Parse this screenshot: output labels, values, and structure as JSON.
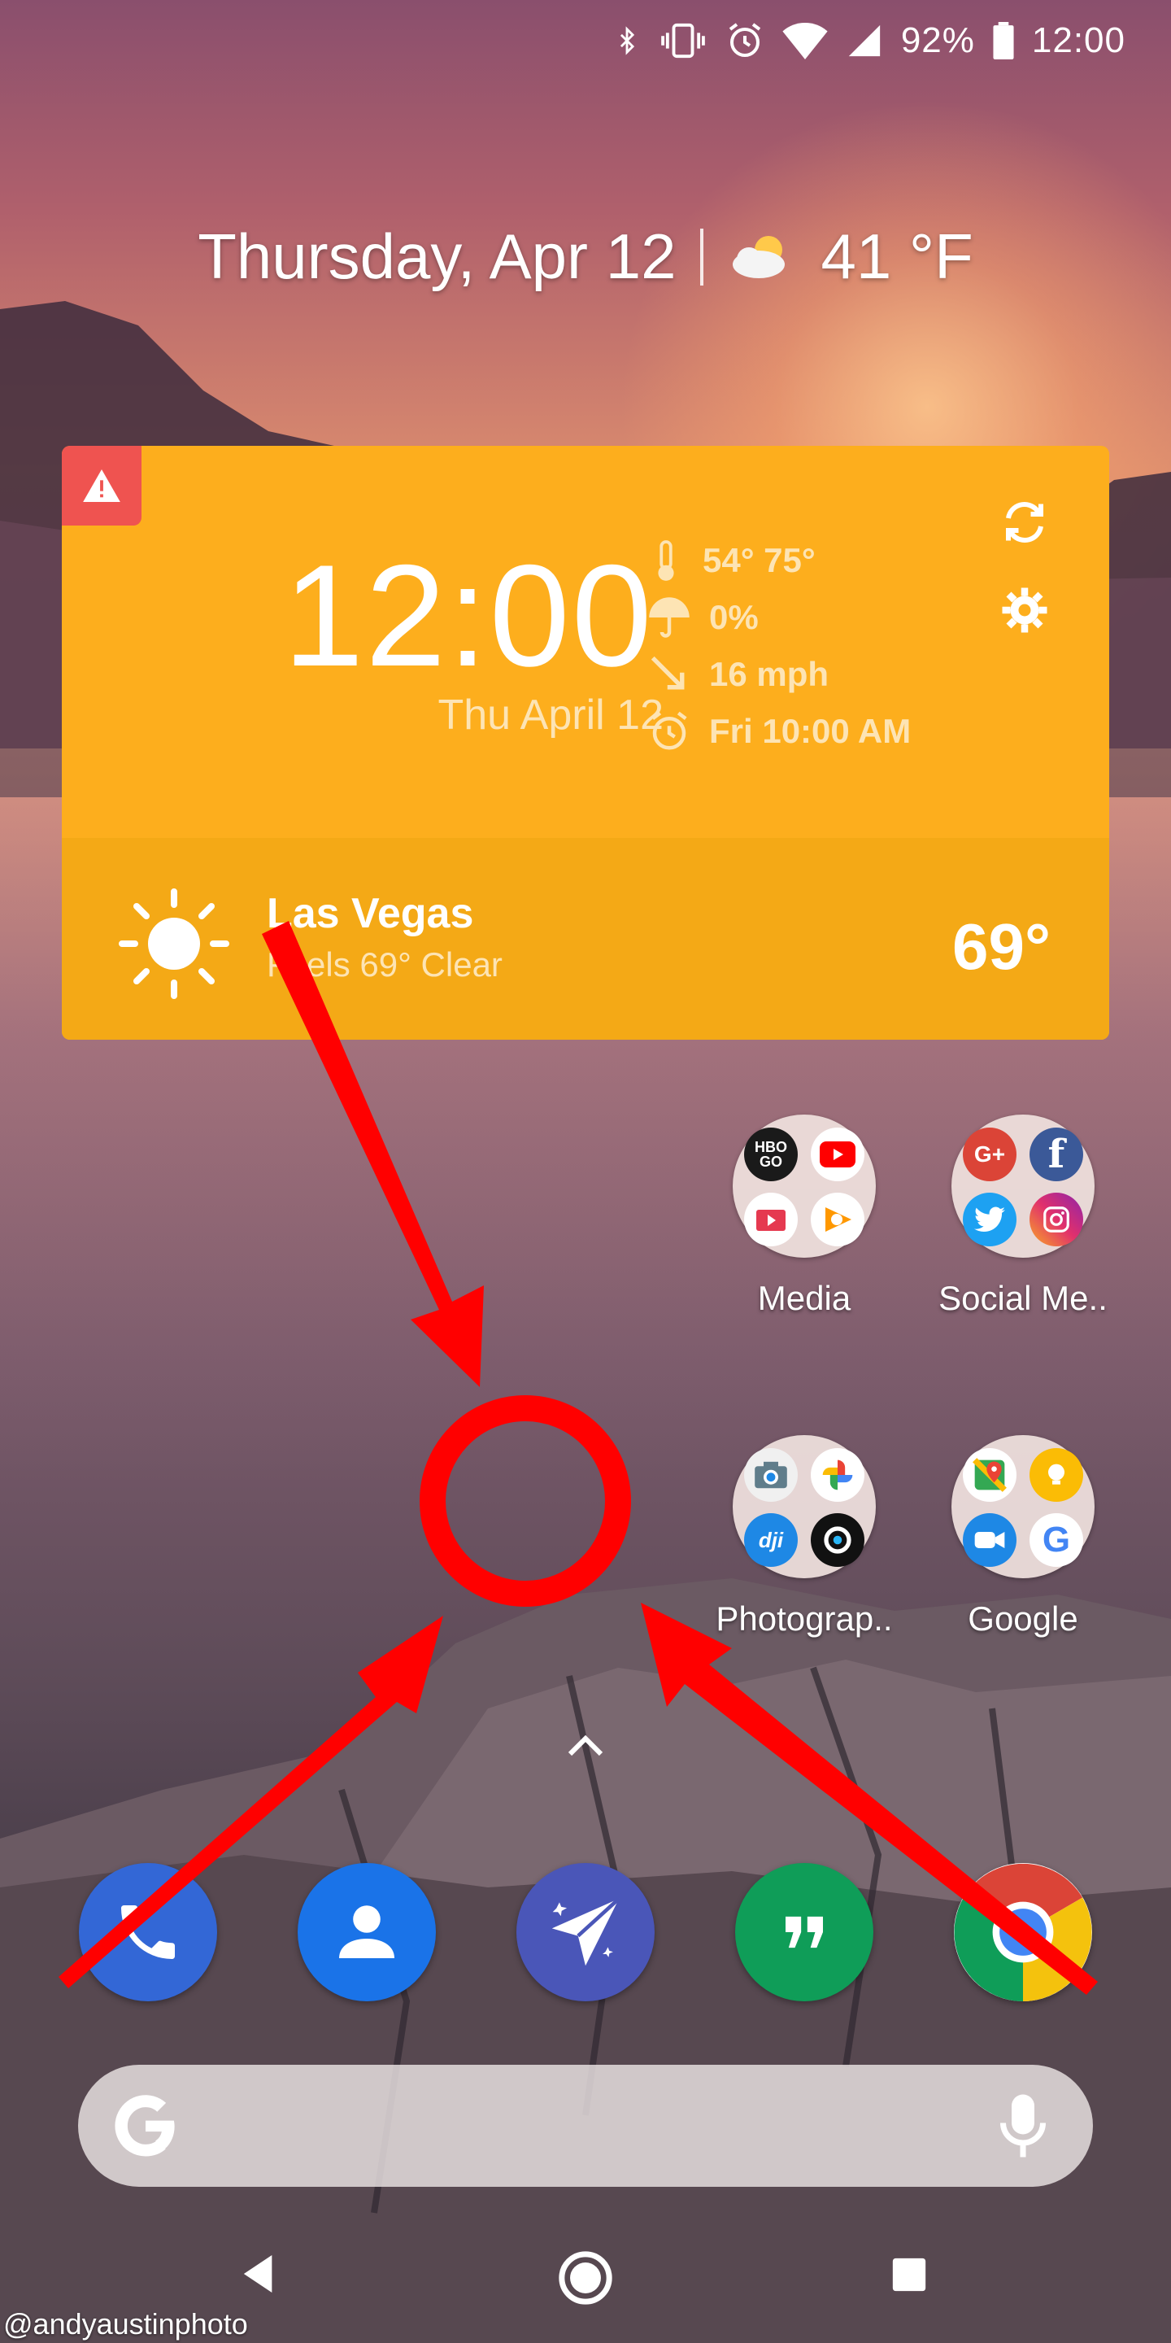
{
  "status_bar": {
    "battery": "92%",
    "time": "12:00"
  },
  "glance": {
    "date": "Thursday, Apr 12",
    "temp": "41 °F"
  },
  "widget": {
    "time": "12:00",
    "date": "Thu April 12",
    "temp_range": "54° 75°",
    "precip": "0%",
    "wind": "16 mph",
    "alarm": "Fri 10:00 AM",
    "city": "Las Vegas",
    "feels": "Feels 69° Clear",
    "current_temp": "69°"
  },
  "folders": [
    {
      "label": "Media"
    },
    {
      "label": "Social Me.."
    },
    {
      "label": "Photograp.."
    },
    {
      "label": "Google"
    }
  ],
  "folder_apps": {
    "media": [
      "HBO GO",
      "YouTube",
      "Play Movies",
      "Play Music"
    ],
    "social": [
      "Google+",
      "Facebook",
      "Twitter",
      "Instagram"
    ],
    "photo": [
      "Camera",
      "Photos",
      "DJI",
      "Camera app"
    ],
    "google": [
      "Maps",
      "Keep",
      "Duo",
      "Google"
    ]
  },
  "folder_badges": {
    "hbo": "HBO GO",
    "gplus": "G+",
    "fb": "f",
    "dji": "dji",
    "google_g": "G"
  },
  "dock": [
    "Phone",
    "Contacts",
    "Newton Mail",
    "Hangouts",
    "Chrome"
  ],
  "search": {
    "logo": "G"
  },
  "watermark": "@andyaustinphoto",
  "colors": {
    "widget": "#fdae1d",
    "widget_bottom": "#f4a916",
    "alert": "#ef5350",
    "annotation": "#ff0000"
  }
}
